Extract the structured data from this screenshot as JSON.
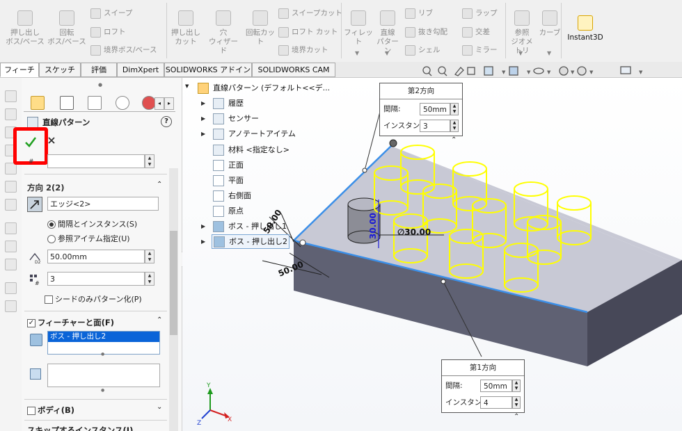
{
  "ribbon": {
    "groups": [
      {
        "label1": "押し出し",
        "label2": "ボス/ベース"
      },
      {
        "label1": "回転",
        "label2": "ボス/ベース"
      },
      {
        "label1": "押し出し",
        "label2": "カット"
      },
      {
        "label1": "穴",
        "label2": "ウィザード"
      },
      {
        "label1": "回転カット",
        "label2": ""
      },
      {
        "label1": "フィレット",
        "label2": ""
      },
      {
        "label1": "直線",
        "label2": "パターン"
      },
      {
        "label1": "参照",
        "label2": "ジオメトリ"
      },
      {
        "label1": "カーブ",
        "label2": ""
      },
      {
        "label1": "Instant3D",
        "label2": ""
      }
    ],
    "small": {
      "sweep": "スイープ",
      "loft": "ロフト",
      "boundary_boss": "境界ボス/ベース",
      "sweep_cut": "スイープカット",
      "loft_cut": "ロフト カット",
      "boundary_cut": "境界カット",
      "rib": "リブ",
      "draft": "抜き勾配",
      "shell": "シェル",
      "wrap": "ラップ",
      "intersect": "交差",
      "mirror": "ミラー"
    }
  },
  "tabs": [
    "フィーチャー",
    "スケッチ",
    "評価",
    "DimXpert",
    "SOLIDWORKS アドイン",
    "SOLIDWORKS CAM"
  ],
  "panel": {
    "title": "直線パターン",
    "help": "?",
    "direction2": {
      "header": "方向 2(2)",
      "edge": "エッジ<2>",
      "opt_spacing": "間隔とインスタンス(S)",
      "opt_ref": "参照アイテム指定(U)",
      "spacing": "50.00mm",
      "instances": "3",
      "seed_only": "シードのみパターン化(P)"
    },
    "features": {
      "header": "フィーチャーと面(F)",
      "selected": "ボス - 押し出し2"
    },
    "bodies": {
      "header": "ボディ(B)"
    },
    "skip": {
      "header": "スキップするインスタンス(I)"
    }
  },
  "tree": {
    "root": "直線パターン (デフォルト<<デ...",
    "items": [
      "履歴",
      "センサー",
      "アノテートアイテム",
      "材料 <指定なし>",
      "正面",
      "平面",
      "右側面",
      "原点",
      "ボス - 押し出し1",
      "ボス - 押し出し2"
    ]
  },
  "callouts": {
    "dir2": {
      "title": "第2方向",
      "spacing_label": "間隔:",
      "spacing": "50mm",
      "instances_label": "インスタンス:",
      "instances": "3"
    },
    "dir1": {
      "title": "第1方向",
      "spacing_label": "間隔:",
      "spacing": "50mm",
      "instances_label": "インスタンス:",
      "instances": "4"
    }
  },
  "dims": {
    "d1": "50.00",
    "d2": "30.00",
    "d3": "∅30.00",
    "d4": "50.00"
  },
  "triad": {
    "x": "X",
    "y": "Y",
    "z": "Z"
  },
  "colors": {
    "pattern": "#ffff00",
    "edge": "#3b8fe8",
    "dim": "#1a1ad6",
    "highlight": "#ff0000"
  }
}
